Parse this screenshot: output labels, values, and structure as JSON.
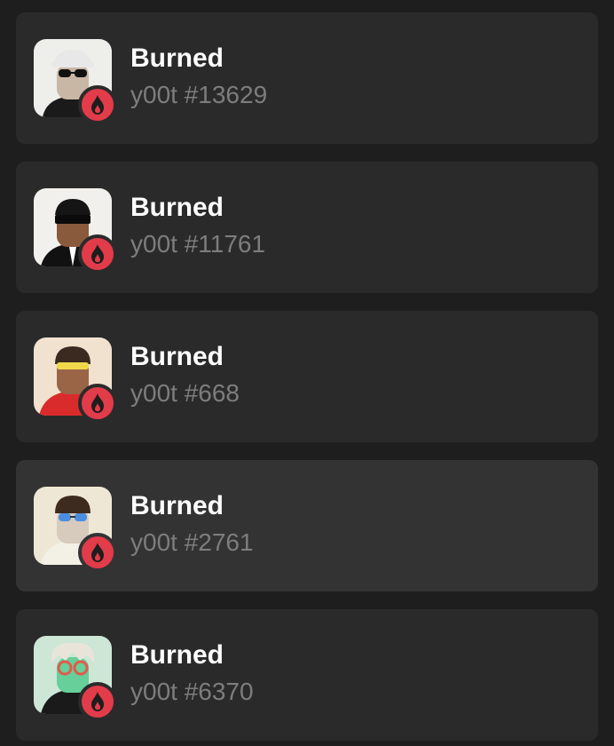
{
  "items": [
    {
      "title": "Burned",
      "subtitle": "y00t #13629",
      "avatar_bg": "#eeeeea",
      "skin": "#c9b7a5",
      "shirt": "#1a1a1a",
      "hair": "#e8e8e8",
      "glasses": "#111111"
    },
    {
      "title": "Burned",
      "subtitle": "y00t #11761",
      "avatar_bg": "#f2f0ec",
      "skin": "#8a5a3c",
      "shirt": "#111111",
      "hair": "#151515",
      "glasses": "#0b0b0b"
    },
    {
      "title": "Burned",
      "subtitle": "y00t #668",
      "avatar_bg": "#f1e2cf",
      "skin": "#9a6447",
      "shirt": "#d92b2b",
      "hair": "#3a2a20",
      "glasses": "#f0d84a"
    },
    {
      "title": "Burned",
      "subtitle": "y00t #2761",
      "avatar_bg": "#efe7d6",
      "skin": "#d7cbbd",
      "shirt": "#f3f0e6",
      "hair": "#3d2b1f",
      "glasses": "#4b8de0"
    },
    {
      "title": "Burned",
      "subtitle": "y00t #6370",
      "avatar_bg": "#cde6d6",
      "skin": "#67cf9a",
      "shirt": "#1a1a1a",
      "hair": "#e9e4da",
      "glasses": "#e25a4a"
    }
  ],
  "badge_icon": "fire-icon",
  "colors": {
    "card": "#2a2a2a",
    "card_hover": "#333333",
    "badge": "#e23b4a",
    "title": "#ffffff",
    "subtitle": "#7d7d7d"
  }
}
